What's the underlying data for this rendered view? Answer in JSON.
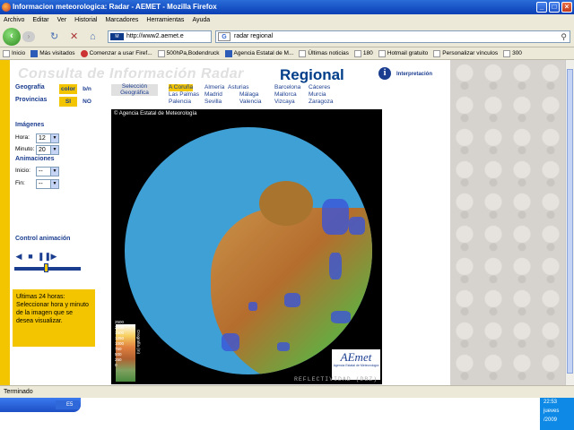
{
  "window": {
    "title": "Informacion meteorologica: Radar - AEMET - Mozilla Firefox"
  },
  "menu": [
    "Archivo",
    "Editar",
    "Ver",
    "Historial",
    "Marcadores",
    "Herramientas",
    "Ayuda"
  ],
  "nav": {
    "url": "http://www2.aemet.e",
    "search": "radar regional"
  },
  "bookmarks": [
    "Inicio",
    "Más visitados",
    "Comenzar a usar Firef...",
    "500hPa,Bodendruck",
    "Agencia Estatal de M...",
    "Últimas noticias",
    "180",
    "Hotmail gratuito",
    "Personalizar vínculos",
    "300"
  ],
  "header": {
    "title": "Consulta de Información Radar",
    "regional": "Regional",
    "interpretacion": "Interpretación"
  },
  "left": {
    "geografia": "Geografía",
    "provincias": "Provincias",
    "color": "color",
    "bn": "b/n",
    "si": "SI",
    "no": "NO",
    "imagenes": "Imágenes",
    "hora_label": "Hora:",
    "hora": "12",
    "minuto_label": "Minuto:",
    "minuto": "20",
    "animaciones": "Animaciones",
    "inicio_label": "Inicio:",
    "inicio": "--",
    "fin_label": "Fin:",
    "fin": "--",
    "control": "Control animación",
    "help": "Ultimas 24 horas: Seleccionar hora y minuto de la imagen que se desea visualizar."
  },
  "tabs": {
    "seleccion": "Selección Geográfica"
  },
  "cities": [
    [
      "A Coruña",
      "Almería",
      "Asturias",
      "Barcelona",
      "Cáceres"
    ],
    [
      "Las Palmas",
      "Madrid",
      "Málaga",
      "Mallorca",
      "Murcia"
    ],
    [
      "Palencia",
      "Sevilla",
      "Valencia",
      "Vizcaya",
      "Zaragoza"
    ]
  ],
  "radar": {
    "caption": "© Agencia Estatal de Meteorología",
    "reflectividad": "REFLECTIVIDAD (DBZ)",
    "legend_label": "Orografía (m)",
    "legend_vals": [
      "2500",
      "2000",
      "1500",
      "1250",
      "1000",
      "750",
      "500",
      "250",
      "0"
    ],
    "logo": "AEmet",
    "logo_sub": "Agencia Estatal de Meteorología"
  },
  "status": "Terminado",
  "taskbar": {
    "e5": "E5",
    "time": "22:53",
    "day": "jueves",
    "date": "/2009"
  }
}
